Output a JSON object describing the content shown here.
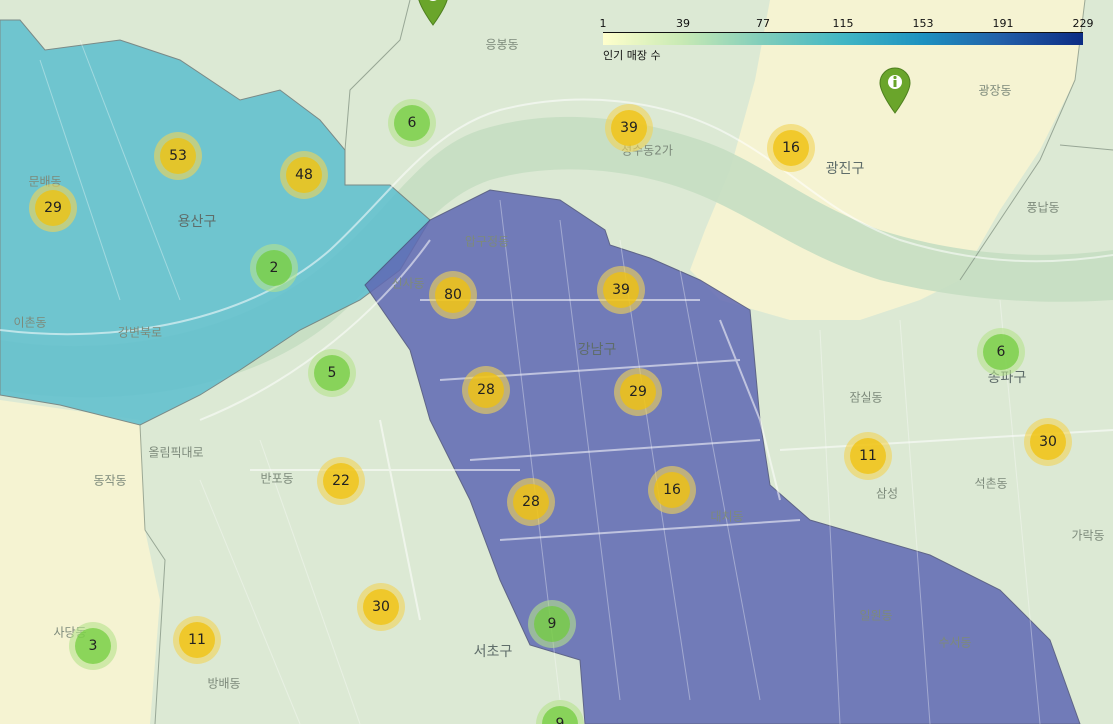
{
  "legend": {
    "caption": "인기 매장 수",
    "ticks": [
      "1",
      "39",
      "77",
      "115",
      "153",
      "191",
      "229"
    ],
    "colors": [
      "#ffffcc",
      "#c7e9b4",
      "#7fcdbb",
      "#41b6c4",
      "#1d91c0",
      "#225ea8",
      "#0c2c84"
    ]
  },
  "labels": [
    {
      "text": "용산구",
      "kind": "district"
    },
    {
      "text": "강남구",
      "kind": "district"
    },
    {
      "text": "광진구",
      "kind": "district"
    },
    {
      "text": "송파구",
      "kind": "district"
    },
    {
      "text": "서초구",
      "kind": "district"
    },
    {
      "text": "문배동",
      "kind": "dong"
    },
    {
      "text": "이촌동",
      "kind": "dong"
    },
    {
      "text": "압구정동",
      "kind": "dong"
    },
    {
      "text": "신사동",
      "kind": "dong"
    },
    {
      "text": "응봉동",
      "kind": "dong"
    },
    {
      "text": "성수동2가",
      "kind": "dong"
    },
    {
      "text": "광장동",
      "kind": "dong"
    },
    {
      "text": "풍납동",
      "kind": "dong"
    },
    {
      "text": "잠실동",
      "kind": "dong"
    },
    {
      "text": "석촌동",
      "kind": "dong"
    },
    {
      "text": "가락동",
      "kind": "dong"
    },
    {
      "text": "대치동",
      "kind": "dong"
    },
    {
      "text": "일원동",
      "kind": "dong"
    },
    {
      "text": "수서동",
      "kind": "dong"
    },
    {
      "text": "반포동",
      "kind": "dong"
    },
    {
      "text": "방배동",
      "kind": "dong"
    },
    {
      "text": "동작동",
      "kind": "dong"
    },
    {
      "text": "사당동",
      "kind": "dong"
    },
    {
      "text": "강변북로",
      "kind": "road"
    },
    {
      "text": "올림픽대로",
      "kind": "road"
    },
    {
      "text": "삼성",
      "kind": "dong"
    }
  ],
  "clusters": [
    {
      "count": "53",
      "size": "medium"
    },
    {
      "count": "48",
      "size": "medium"
    },
    {
      "count": "29",
      "size": "medium"
    },
    {
      "count": "6",
      "size": "small"
    },
    {
      "count": "2",
      "size": "small"
    },
    {
      "count": "39",
      "size": "medium"
    },
    {
      "count": "16",
      "size": "medium"
    },
    {
      "count": "80",
      "size": "medium"
    },
    {
      "count": "39",
      "size": "medium"
    },
    {
      "count": "5",
      "size": "small"
    },
    {
      "count": "28",
      "size": "medium"
    },
    {
      "count": "29",
      "size": "medium"
    },
    {
      "count": "22",
      "size": "medium"
    },
    {
      "count": "28",
      "size": "medium"
    },
    {
      "count": "16",
      "size": "medium"
    },
    {
      "count": "6",
      "size": "small"
    },
    {
      "count": "11",
      "size": "medium"
    },
    {
      "count": "30",
      "size": "medium"
    },
    {
      "count": "30",
      "size": "medium"
    },
    {
      "count": "3",
      "size": "small"
    },
    {
      "count": "11",
      "size": "medium"
    },
    {
      "count": "9",
      "size": "small"
    },
    {
      "count": "9",
      "size": "small"
    }
  ],
  "pins": [
    {
      "icon": "info-icon"
    },
    {
      "icon": "info-icon"
    }
  ]
}
